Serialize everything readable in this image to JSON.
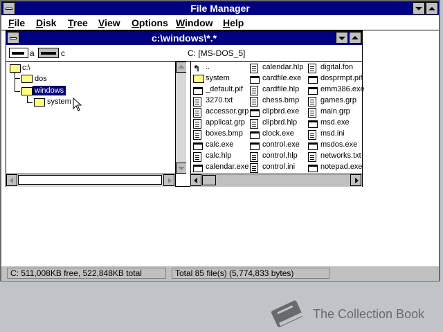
{
  "app": {
    "title": "File Manager"
  },
  "menu": [
    {
      "label": "File",
      "u": "F",
      "rest": "ile"
    },
    {
      "label": "Disk",
      "u": "D",
      "rest": "isk"
    },
    {
      "label": "Tree",
      "u": "T",
      "rest": "ree"
    },
    {
      "label": "View",
      "u": "V",
      "rest": "iew"
    },
    {
      "label": "Options",
      "u": "O",
      "rest": "ptions"
    },
    {
      "label": "Window",
      "u": "W",
      "rest": "indow"
    },
    {
      "label": "Help",
      "u": "H",
      "rest": "elp"
    }
  ],
  "window": {
    "title": "c:\\windows\\*.*"
  },
  "drives": [
    {
      "letter": "a"
    },
    {
      "letter": "c"
    }
  ],
  "volume_label": "C: [MS-DOS_5]",
  "tree": {
    "root": "c:\\",
    "items": [
      "dos",
      "windows",
      "system"
    ]
  },
  "files": {
    "col1": [
      {
        "name": "..",
        "icon": "up-arrow"
      },
      {
        "name": "system",
        "icon": "folder"
      },
      {
        "name": "_default.pif",
        "icon": "exe"
      },
      {
        "name": "3270.txt",
        "icon": "doc"
      },
      {
        "name": "accessor.grp",
        "icon": "doc"
      },
      {
        "name": "applicat.grp",
        "icon": "doc"
      },
      {
        "name": "boxes.bmp",
        "icon": "doc"
      },
      {
        "name": "calc.exe",
        "icon": "exe"
      },
      {
        "name": "calc.hlp",
        "icon": "doc"
      },
      {
        "name": "calendar.exe",
        "icon": "exe"
      }
    ],
    "col2": [
      {
        "name": "calendar.hlp",
        "icon": "doc"
      },
      {
        "name": "cardfile.exe",
        "icon": "exe"
      },
      {
        "name": "cardfile.hlp",
        "icon": "doc"
      },
      {
        "name": "chess.bmp",
        "icon": "doc"
      },
      {
        "name": "clipbrd.exe",
        "icon": "exe"
      },
      {
        "name": "clipbrd.hlp",
        "icon": "doc"
      },
      {
        "name": "clock.exe",
        "icon": "exe"
      },
      {
        "name": "control.exe",
        "icon": "exe"
      },
      {
        "name": "control.hlp",
        "icon": "doc"
      },
      {
        "name": "control.ini",
        "icon": "doc"
      }
    ],
    "col3": [
      {
        "name": "digital.fon",
        "icon": "doc"
      },
      {
        "name": "dosprmpt.pif",
        "icon": "exe"
      },
      {
        "name": "emm386.exe",
        "icon": "exe"
      },
      {
        "name": "games.grp",
        "icon": "doc"
      },
      {
        "name": "main.grp",
        "icon": "doc"
      },
      {
        "name": "msd.exe",
        "icon": "exe"
      },
      {
        "name": "msd.ini",
        "icon": "doc"
      },
      {
        "name": "msdos.exe",
        "icon": "exe"
      },
      {
        "name": "networks.txt",
        "icon": "doc"
      },
      {
        "name": "notepad.exe",
        "icon": "exe"
      }
    ]
  },
  "status": {
    "disk": "C: 511,008KB free,  522,848KB total",
    "total": "Total 85 file(s) (5,774,833 bytes)"
  },
  "watermark": "The Collection Book"
}
